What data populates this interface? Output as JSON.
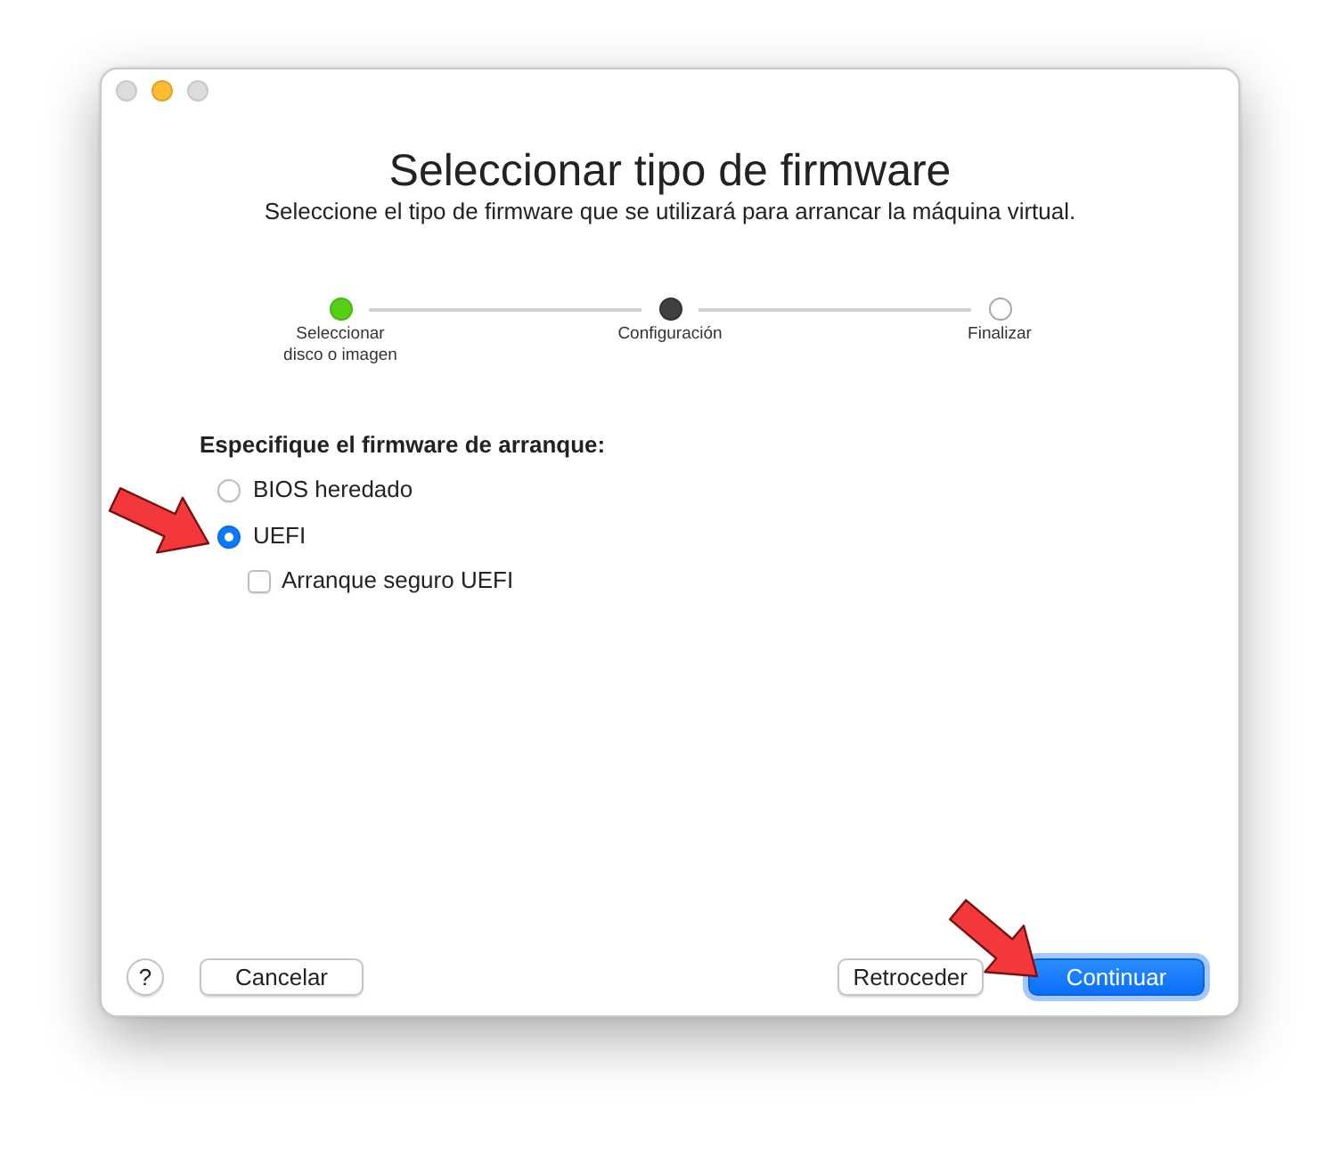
{
  "window": {
    "controls": [
      {
        "kind": "close",
        "disabled": true
      },
      {
        "kind": "minimize",
        "disabled": false
      },
      {
        "kind": "zoom",
        "disabled": true
      }
    ]
  },
  "header": {
    "title": "Seleccionar tipo de firmware",
    "subtitle": "Seleccione el tipo de firmware que se utilizará para arrancar la máquina virtual."
  },
  "steps": [
    {
      "label": "Seleccionar disco o imagen",
      "completed": true,
      "current": false
    },
    {
      "label": "Configuración",
      "completed": false,
      "current": true
    },
    {
      "label": "Finalizar",
      "completed": false,
      "current": false
    }
  ],
  "firmware": {
    "heading": "Especifique el firmware de arranque:",
    "options": [
      {
        "label": "BIOS heredado",
        "selected": false
      },
      {
        "label": "UEFI",
        "selected": true
      }
    ],
    "secure_boot": {
      "label": "Arranque seguro UEFI",
      "checked": false
    }
  },
  "footer": {
    "left": [
      {
        "label": "?",
        "kind": "help"
      },
      {
        "label": "Cancelar",
        "kind": "secondary"
      }
    ],
    "right": [
      {
        "label": "Retroceder",
        "kind": "secondary"
      },
      {
        "label": "Continuar",
        "kind": "primary"
      }
    ]
  }
}
